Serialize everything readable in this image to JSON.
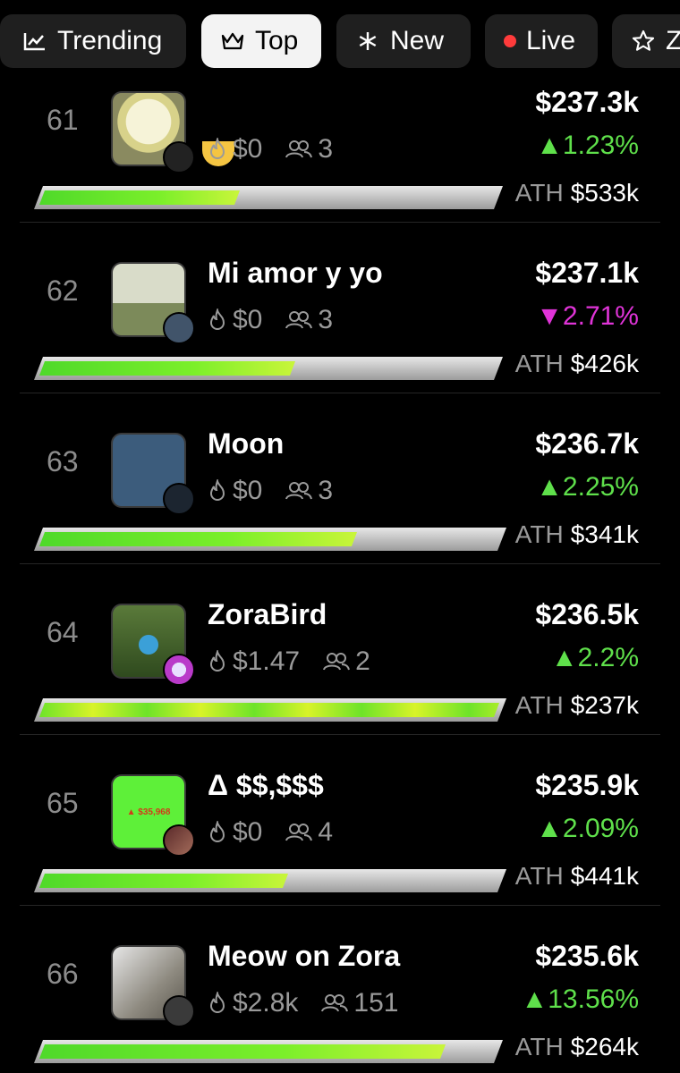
{
  "tabs": [
    {
      "label": "Trending",
      "icon": "trending-chart-icon",
      "active": false
    },
    {
      "label": "Top",
      "icon": "crown-icon",
      "active": true
    },
    {
      "label": "New",
      "icon": "asterisk-icon",
      "active": false
    },
    {
      "label": "Live",
      "icon": "live-dot-icon",
      "active": false
    },
    {
      "label": "Z",
      "icon": "star-icon",
      "active": false
    }
  ],
  "colors": {
    "up": "#5fe04b",
    "down": "#e034d8",
    "bar_fill": "#6ee32a"
  },
  "ath_label": "ATH",
  "coins": [
    {
      "rank": "61",
      "title": "",
      "burn": "$0",
      "holders": "3",
      "mcap": "$237.3k",
      "change": "1.23%",
      "direction": "up",
      "ath": "$533k",
      "progress": 0.44
    },
    {
      "rank": "62",
      "title": "Mi amor y yo",
      "burn": "$0",
      "holders": "3",
      "mcap": "$237.1k",
      "change": "2.71%",
      "direction": "down",
      "ath": "$426k",
      "progress": 0.56
    },
    {
      "rank": "63",
      "title": "Moon",
      "burn": "$0",
      "holders": "3",
      "mcap": "$236.7k",
      "change": "2.25%",
      "direction": "up",
      "ath": "$341k",
      "progress": 0.69
    },
    {
      "rank": "64",
      "title": "ZoraBird",
      "burn": "$1.47",
      "holders": "2",
      "mcap": "$236.5k",
      "change": "2.2%",
      "direction": "up",
      "ath": "$237k",
      "progress": 1.0
    },
    {
      "rank": "65",
      "title": "Δ $$,$$$",
      "burn": "$0",
      "holders": "4",
      "mcap": "$235.9k",
      "change": "2.09%",
      "direction": "up",
      "ath": "$441k",
      "progress": 0.54,
      "thumb_text": "▲ $35,968"
    },
    {
      "rank": "66",
      "title": "Meow on Zora",
      "burn": "$2.8k",
      "holders": "151",
      "mcap": "$235.6k",
      "change": "13.56%",
      "direction": "up",
      "ath": "$264k",
      "progress": 0.89
    }
  ]
}
